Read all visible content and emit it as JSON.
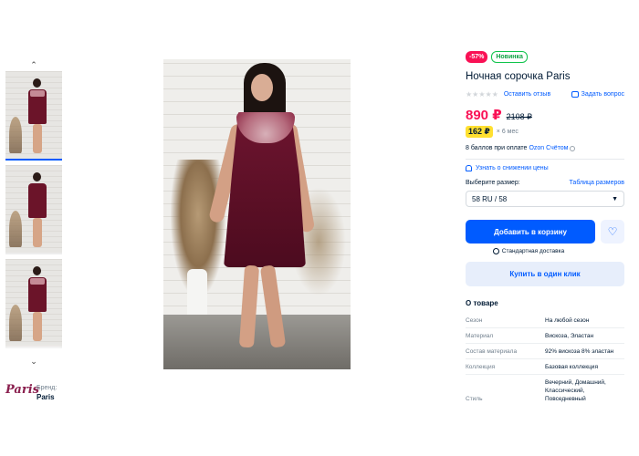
{
  "thumbnails": {
    "up_arrow": "⌃",
    "down_arrow": "⌄",
    "count": 3
  },
  "brand": {
    "logo_text": "Paris",
    "label": "Бренд:",
    "name": "Paris"
  },
  "product": {
    "badges": {
      "discount": "-57%",
      "new": "Новинка"
    },
    "title": "Ночная сорочка Paris",
    "rating": {
      "stars": "★★★★★",
      "review_link": "Оставить отзыв",
      "question_link": "Задать вопрос"
    },
    "price": "890 ₽",
    "old_price": "2108 ₽",
    "installment": {
      "amount": "162 ₽",
      "term": "× 6 мес"
    },
    "points": {
      "text": "8 баллов при оплате",
      "link": "Ozon Счётом"
    },
    "notify_link": "Узнать о снижении цены",
    "size": {
      "label": "Выберите размер:",
      "table_link": "Таблица размеров",
      "selected": "58 RU / 58"
    },
    "cart_button": "Добавить в корзину",
    "delivery": "Стандартная доставка",
    "one_click_button": "Купить в один клик"
  },
  "about": {
    "title": "О товаре",
    "specs": [
      {
        "key": "Сезон",
        "value": "На любой сезон"
      },
      {
        "key": "Материал",
        "value": "Вискоза, Эластан"
      },
      {
        "key": "Состав материала",
        "value": "92% вискоза 8% эластан"
      },
      {
        "key": "Коллекция",
        "value": "Базовая коллекция"
      },
      {
        "key": "Стиль",
        "value": "Вечерний, Домашний, Классический, Повседневный"
      }
    ]
  },
  "colors": {
    "accent": "#005bff",
    "sale": "#f91155",
    "new_badge": "#10c44c",
    "installment": "#ffe030",
    "dress": "#6e1530"
  }
}
